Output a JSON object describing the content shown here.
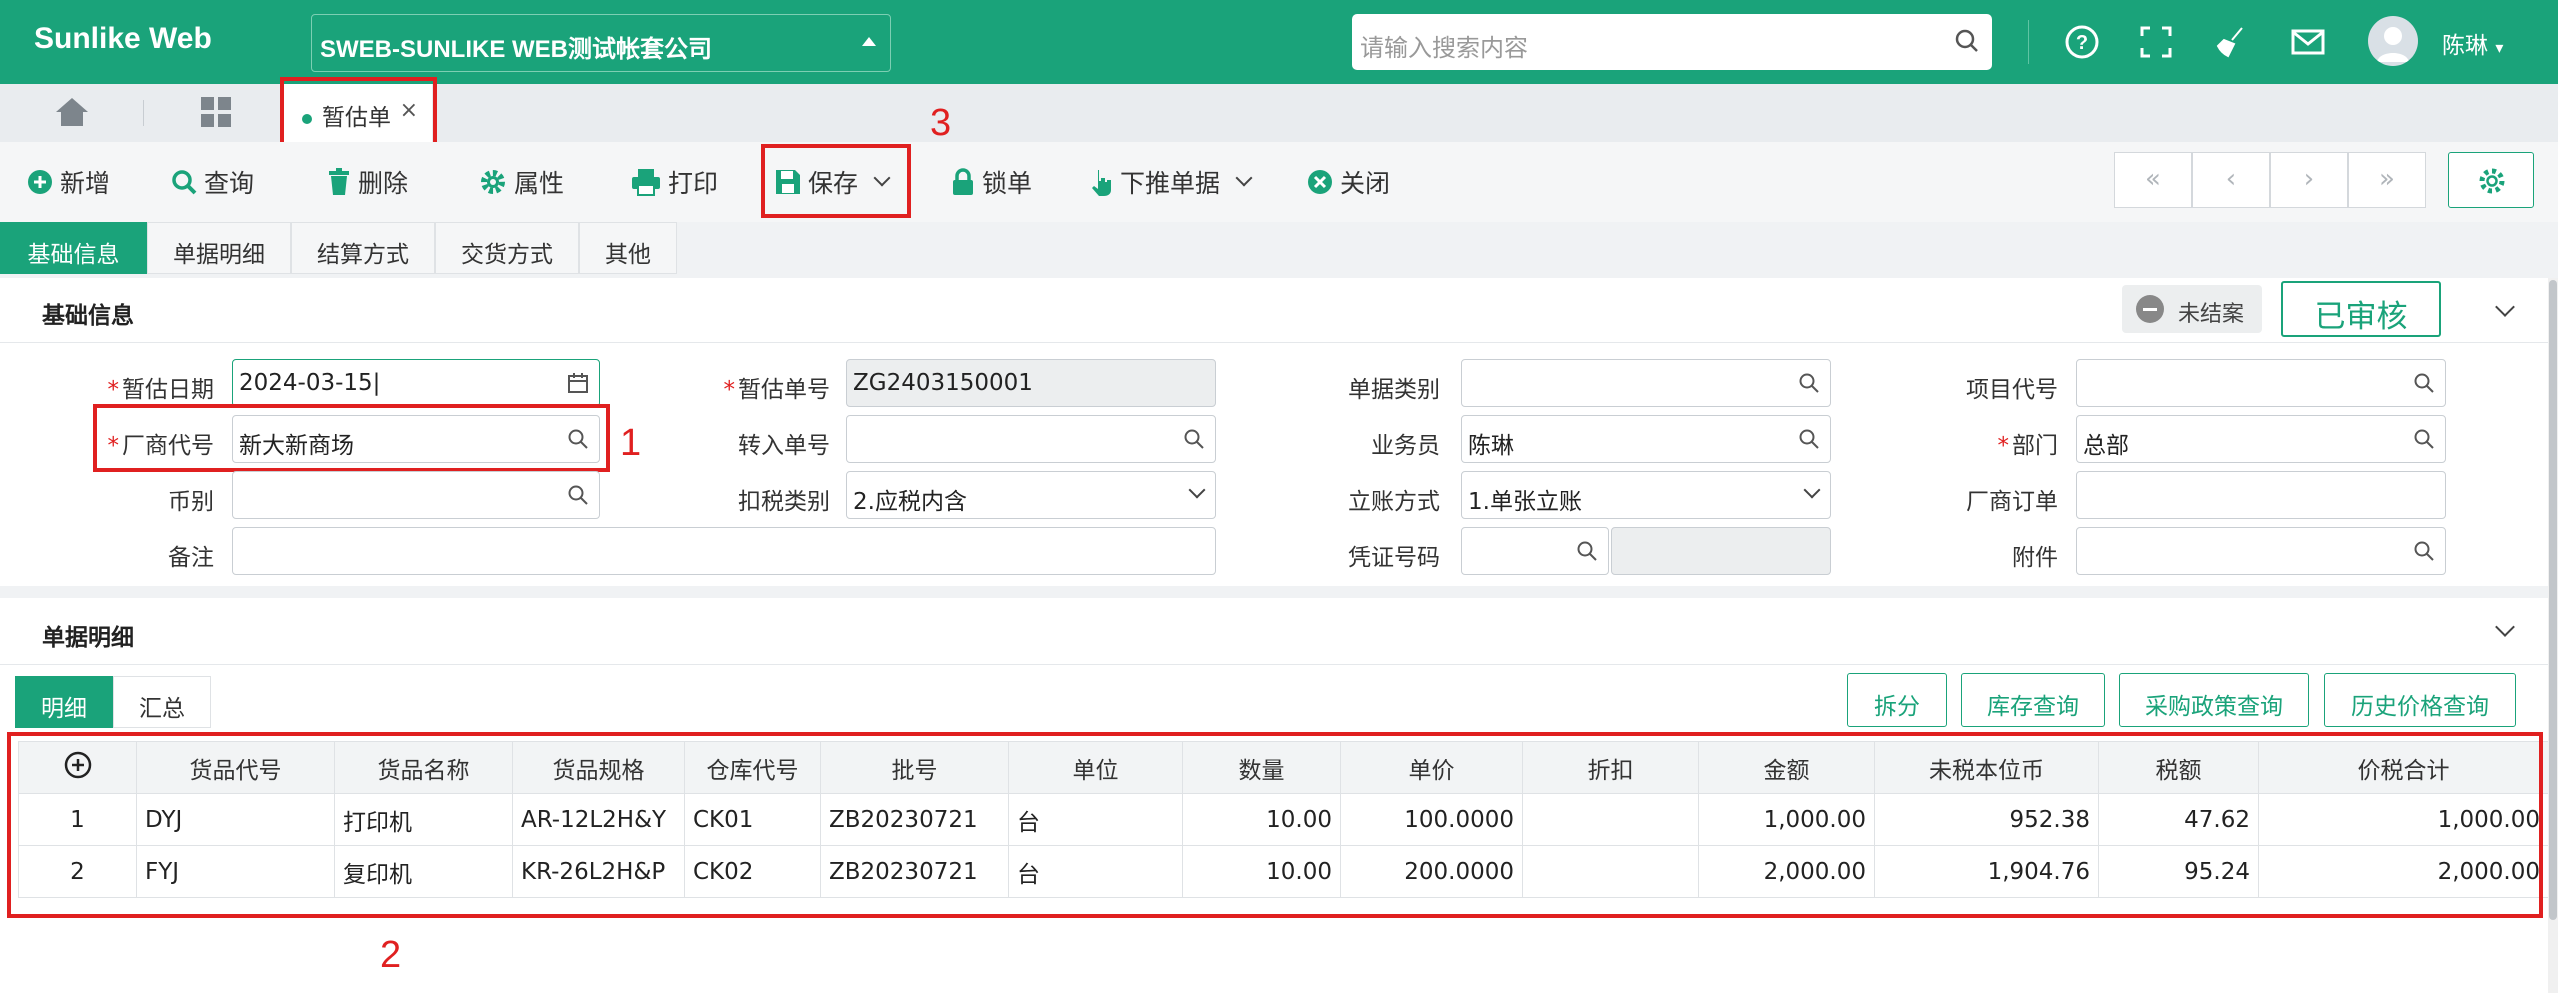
{
  "app": {
    "brand": "Sunlike Web",
    "company": "SWEB-SUNLIKE WEB测试帐套公司",
    "search_placeholder": "请输入搜索内容",
    "user": "陈琳",
    "user_caret": "▾"
  },
  "tabs": {
    "doc_tab_label": "暂估单",
    "close_glyph": "×"
  },
  "toolbar": {
    "add": "新增",
    "query": "查询",
    "delete": "删除",
    "properties": "属性",
    "print": "打印",
    "save": "保存",
    "lock": "锁单",
    "push_down": "下推单据",
    "close": "关闭",
    "first": "«",
    "prev": "‹",
    "next": "›",
    "last": "»"
  },
  "section_tabs": [
    "基础信息",
    "单据明细",
    "结算方式",
    "交货方式",
    "其他"
  ],
  "basic": {
    "title": "基础信息",
    "status": "未结案",
    "audit": "已审核",
    "labels": {
      "est_date": "暂估日期",
      "vendor_code": "厂商代号",
      "currency": "币别",
      "remark": "备注",
      "est_no": "暂估单号",
      "transfer_no": "转入单号",
      "tax_type": "扣税类别",
      "doc_type": "单据类别",
      "salesman": "业务员",
      "account_method": "立账方式",
      "voucher_no": "凭证号码",
      "project_code": "项目代号",
      "dept": "部门",
      "vendor_order": "厂商订单",
      "attachment": "附件"
    },
    "values": {
      "est_date": "2024-03-15",
      "vendor_code": "新大新商场",
      "currency": "",
      "remark": "",
      "est_no": "ZG2403150001",
      "transfer_no": "",
      "tax_type": "2.应税内含",
      "doc_type": "",
      "salesman": "陈琳",
      "account_method": "1.单张立账",
      "voucher_no": "",
      "project_code": "",
      "dept": "总部",
      "vendor_order": "",
      "attachment": ""
    }
  },
  "detail": {
    "title": "单据明细",
    "view_tabs": [
      "明细",
      "汇总"
    ],
    "buttons": [
      "拆分",
      "库存查询",
      "采购政策查询",
      "历史价格查询"
    ],
    "columns": [
      "货品代号",
      "货品名称",
      "货品规格",
      "仓库代号",
      "批号",
      "单位",
      "数量",
      "单价",
      "折扣",
      "金额",
      "未税本位币",
      "税额",
      "价税合计"
    ],
    "rows": [
      {
        "no": "1",
        "code": "DYJ",
        "name": "打印机",
        "spec": "AR-12L2H&Y",
        "wh": "CK01",
        "batch": "ZB20230721",
        "unit": "台",
        "qty": "10.00",
        "price": "100.0000",
        "discount": "",
        "amount": "1,000.00",
        "untaxed": "952.38",
        "tax": "47.62",
        "total": "1,000.00"
      },
      {
        "no": "2",
        "code": "FYJ",
        "name": "复印机",
        "spec": "KR-26L2H&P",
        "wh": "CK02",
        "batch": "ZB20230721",
        "unit": "台",
        "qty": "10.00",
        "price": "200.0000",
        "discount": "",
        "amount": "2,000.00",
        "untaxed": "1,904.76",
        "tax": "95.24",
        "total": "2,000.00"
      }
    ]
  },
  "annotations": {
    "mark1": "1",
    "mark2": "2",
    "mark3": "3"
  },
  "colors": {
    "brand": "#1aa37a",
    "annotation": "#e02020"
  }
}
